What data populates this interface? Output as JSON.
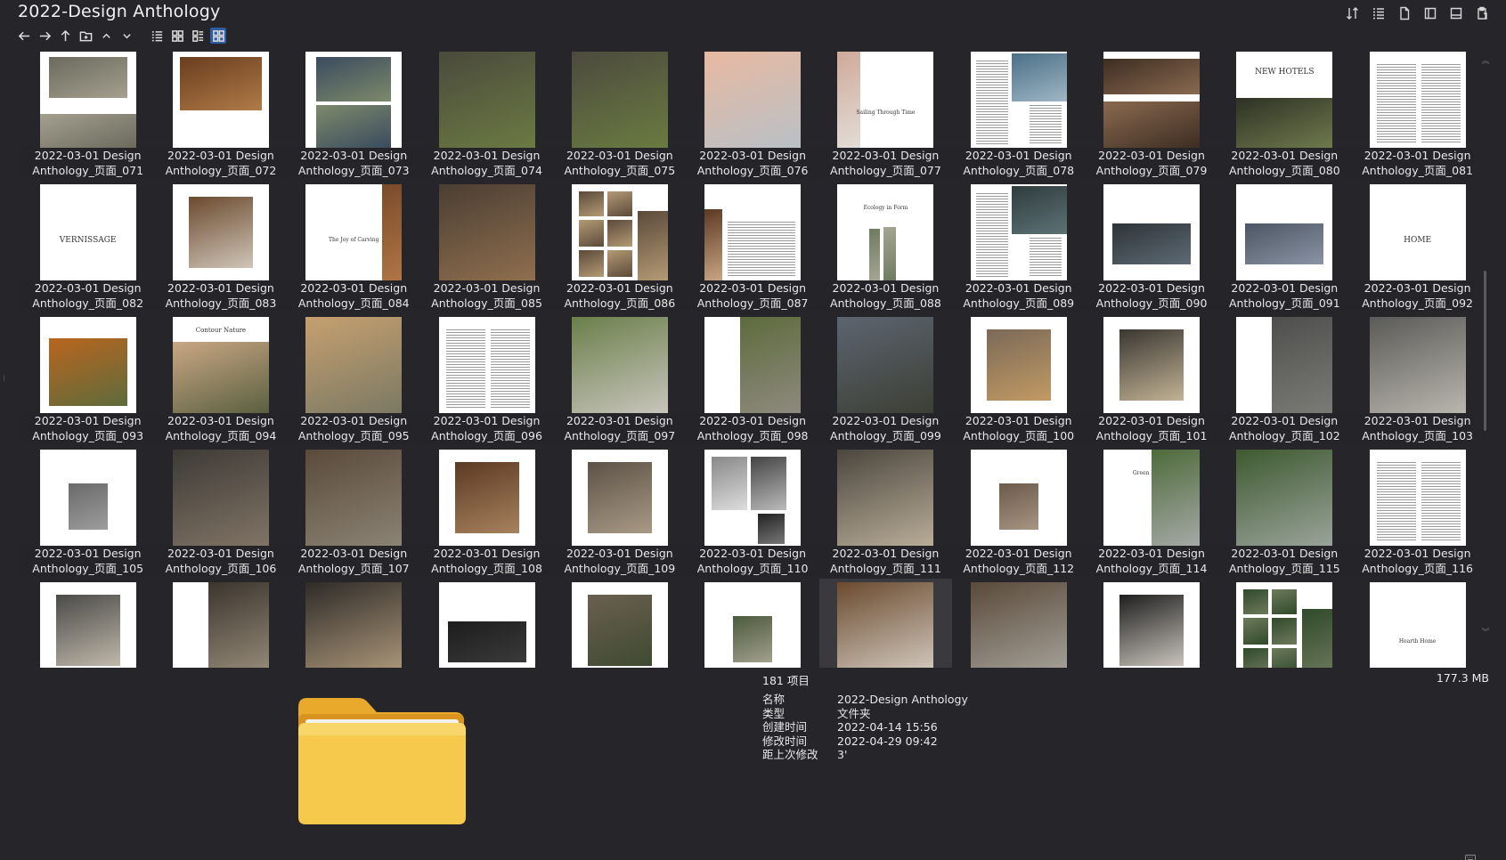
{
  "window": {
    "title": "2022-Design Anthology"
  },
  "top_tools": [
    {
      "name": "sort-icon"
    },
    {
      "name": "list-view-icon"
    },
    {
      "name": "document-icon"
    },
    {
      "name": "preview-pane-icon"
    },
    {
      "name": "details-pane-icon"
    },
    {
      "name": "clipboard-icon"
    }
  ],
  "nav": {
    "back": "back-arrow-icon",
    "forward": "forward-arrow-icon",
    "up": "up-arrow-icon",
    "new_folder": "new-folder-icon"
  },
  "tiles": [
    {
      "label1": "2022-03-01 Design",
      "label2": "Anthology_页面_071",
      "img": "room",
      "c1": "#6b6a5c",
      "c2": "#a4a090"
    },
    {
      "label1": "2022-03-01 Design",
      "label2": "Anthology_页面_072",
      "img": "wood",
      "c1": "#6a3d1f",
      "c2": "#b07b47"
    },
    {
      "label1": "2022-03-01 Design",
      "label2": "Anthology_页面_073",
      "img": "group",
      "c1": "#3a4b5e",
      "c2": "#7d8a6b"
    },
    {
      "label1": "2022-03-01 Design",
      "label2": "Anthology_页面_074",
      "img": "full",
      "c1": "#4a4a3c",
      "c2": "#6b7a42"
    },
    {
      "label1": "2022-03-01 Design",
      "label2": "Anthology_页面_075",
      "img": "full",
      "c1": "#4c4a3e",
      "c2": "#6a7b40"
    },
    {
      "label1": "2022-03-01 Design",
      "label2": "Anthology_页面_076",
      "img": "sea",
      "c1": "#e8b9a0",
      "c2": "#b9c0c6"
    },
    {
      "label1": "2022-03-01 Design",
      "label2": "Anthology_页面_077",
      "img": "splitTitle",
      "text": "Sailing Through Time",
      "c1": "#cfa99a",
      "c2": "#e2ddd6"
    },
    {
      "label1": "2022-03-01 Design",
      "label2": "Anthology_页面_078",
      "img": "textPhoto",
      "c1": "#4b6f86",
      "c2": "#9fb7c5"
    },
    {
      "label1": "2022-03-01 Design",
      "label2": "Anthology_页面_079",
      "img": "hotel",
      "c1": "#8a6a50",
      "c2": "#3d2d22"
    },
    {
      "label1": "2022-03-01 Design",
      "label2": "Anthology_页面_080",
      "img": "titleTop",
      "text": "NEW HOTELS",
      "c1": "#2d3124",
      "c2": "#6f7a4d"
    },
    {
      "label1": "2022-03-01 Design",
      "label2": "Anthology_页面_081",
      "img": "text",
      "c1": "#999",
      "c2": "#bbb"
    },
    {
      "label1": "2022-03-01 Design",
      "label2": "Anthology_页面_082",
      "img": "title",
      "text": "VERNISSAGE",
      "c1": "#fff",
      "c2": "#fff"
    },
    {
      "label1": "2022-03-01 Design",
      "label2": "Anthology_页面_083",
      "img": "center",
      "c1": "#6b4a2e",
      "c2": "#cfc5b8"
    },
    {
      "label1": "2022-03-01 Design",
      "label2": "Anthology_页面_084",
      "img": "smallTitleEdge",
      "text": "The Joy of Carving",
      "c1": "#7a4b2a",
      "c2": "#b07545"
    },
    {
      "label1": "2022-03-01 Design",
      "label2": "Anthology_页面_085",
      "img": "full",
      "c1": "#4b3e33",
      "c2": "#8f6f4e"
    },
    {
      "label1": "2022-03-01 Design",
      "label2": "Anthology_页面_086",
      "img": "collage",
      "c1": "#5b4a3a",
      "c2": "#b49a75"
    },
    {
      "label1": "2022-03-01 Design",
      "label2": "Anthology_页面_087",
      "img": "textLeftPhoto",
      "c1": "#5a3a23",
      "c2": "#c7a583"
    },
    {
      "label1": "2022-03-01 Design",
      "label2": "Anthology_页面_088",
      "img": "titleObj",
      "text": "Ecology in Form",
      "c1": "#6d7b5e",
      "c2": "#a6a693"
    },
    {
      "label1": "2022-03-01 Design",
      "label2": "Anthology_页面_089",
      "img": "textPhoto",
      "c1": "#2f3c3e",
      "c2": "#5d7275"
    },
    {
      "label1": "2022-03-01 Design",
      "label2": "Anthology_页面_090",
      "img": "centerDark",
      "c1": "#2e3438",
      "c2": "#5d6a74"
    },
    {
      "label1": "2022-03-01 Design",
      "label2": "Anthology_页面_091",
      "img": "centerDark",
      "c1": "#4b5563",
      "c2": "#8a94a4"
    },
    {
      "label1": "2022-03-01 Design",
      "label2": "Anthology_页面_092",
      "img": "title",
      "text": "HOME",
      "c1": "#fff",
      "c2": "#fff"
    },
    {
      "label1": "2022-03-01 Design",
      "label2": "Anthology_页面_093",
      "img": "autumn",
      "c1": "#b9651e",
      "c2": "#5e6b3c"
    },
    {
      "label1": "2022-03-01 Design",
      "label2": "Anthology_页面_094",
      "img": "titleScene",
      "text": "Contour Nature",
      "c1": "#c9a784",
      "c2": "#5a6040"
    },
    {
      "label1": "2022-03-01 Design",
      "label2": "Anthology_页面_095",
      "img": "full",
      "c1": "#c6a06f",
      "c2": "#7b7964"
    },
    {
      "label1": "2022-03-01 Design",
      "label2": "Anthology_页面_096",
      "img": "text",
      "c1": "#999",
      "c2": "#bbb"
    },
    {
      "label1": "2022-03-01 Design",
      "label2": "Anthology_页面_097",
      "img": "full",
      "c1": "#6a7f4a",
      "c2": "#c8c5bb"
    },
    {
      "label1": "2022-03-01 Design",
      "label2": "Anthology_页面_098",
      "img": "rightPhoto",
      "c1": "#5d6b3c",
      "c2": "#8e8a7e"
    },
    {
      "label1": "2022-03-01 Design",
      "label2": "Anthology_页面_099",
      "img": "full",
      "c1": "#5c6470",
      "c2": "#3c3f34"
    },
    {
      "label1": "2022-03-01 Design",
      "label2": "Anthology_页面_100",
      "img": "center",
      "c1": "#7a6a58",
      "c2": "#c29a63"
    },
    {
      "label1": "2022-03-01 Design",
      "label2": "Anthology_页面_101",
      "img": "center",
      "c1": "#3a3632",
      "c2": "#c2b394"
    },
    {
      "label1": "2022-03-01 Design",
      "label2": "Anthology_页面_102",
      "img": "rightPhoto",
      "c1": "#4e4e4c",
      "c2": "#7b7b76"
    },
    {
      "label1": "2022-03-01 Design",
      "label2": "Anthology_页面_103",
      "img": "full",
      "c1": "#5a5a58",
      "c2": "#b9b6ad"
    },
    {
      "label1": "2022-03-01 Design",
      "label2": "Anthology_页面_105",
      "img": "smallCenter",
      "c1": "#6a6a6a",
      "c2": "#9d9d9d"
    },
    {
      "label1": "2022-03-01 Design",
      "label2": "Anthology_页面_106",
      "img": "full",
      "c1": "#3d3a36",
      "c2": "#817465"
    },
    {
      "label1": "2022-03-01 Design",
      "label2": "Anthology_页面_107",
      "img": "full",
      "c1": "#5a4a3a",
      "c2": "#8b8374"
    },
    {
      "label1": "2022-03-01 Design",
      "label2": "Anthology_页面_108",
      "img": "center",
      "c1": "#5b3a23",
      "c2": "#a8825e"
    },
    {
      "label1": "2022-03-01 Design",
      "label2": "Anthology_页面_109",
      "img": "center",
      "c1": "#5c5246",
      "c2": "#a99a86"
    },
    {
      "label1": "2022-03-01 Design",
      "label2": "Anthology_页面_110",
      "img": "collage2",
      "c1": "#333",
      "c2": "#aaa"
    },
    {
      "label1": "2022-03-01 Design",
      "label2": "Anthology_页面_111",
      "img": "full",
      "c1": "#4b463e",
      "c2": "#b9ad98"
    },
    {
      "label1": "2022-03-01 Design",
      "label2": "Anthology_页面_112",
      "img": "smallCenter",
      "c1": "#6a5a4a",
      "c2": "#a89583"
    },
    {
      "label1": "2022-03-01 Design",
      "label2": "Anthology_页面_114",
      "img": "titleRightPhoto",
      "text": "Green Escape",
      "c1": "#4e6b3a",
      "c2": "#a5a9a6"
    },
    {
      "label1": "2022-03-01 Design",
      "label2": "Anthology_页面_115",
      "img": "full",
      "c1": "#3e5a30",
      "c2": "#9aa39a"
    },
    {
      "label1": "2022-03-01 Design",
      "label2": "Anthology_页面_116",
      "img": "text",
      "c1": "#999",
      "c2": "#bbb"
    },
    {
      "label1": "",
      "label2": "",
      "img": "center",
      "c1": "#4a4a48",
      "c2": "#c0b8aa"
    },
    {
      "label1": "",
      "label2": "",
      "img": "rightPhoto",
      "c1": "#3b352e",
      "c2": "#9b8f7c"
    },
    {
      "label1": "",
      "label2": "",
      "img": "full",
      "c1": "#2e2b28",
      "c2": "#b29c7d"
    },
    {
      "label1": "",
      "label2": "",
      "img": "centerDark",
      "c1": "#1d1d1d",
      "c2": "#3a3a3a"
    },
    {
      "label1": "",
      "label2": "",
      "img": "center",
      "c1": "#6a5f50",
      "c2": "#3f4a32"
    },
    {
      "label1": "",
      "label2": "",
      "img": "smallCenter",
      "c1": "#4c5a3b",
      "c2": "#a2a08f"
    },
    {
      "label1": "",
      "label2": "",
      "img": "full",
      "c1": "#6a4a2e",
      "c2": "#d8d0c6",
      "selected": true
    },
    {
      "label1": "",
      "label2": "",
      "img": "full",
      "c1": "#5a4a3a",
      "c2": "#a8a59d"
    },
    {
      "label1": "",
      "label2": "",
      "img": "center",
      "c1": "#1e1e1e",
      "c2": "#c9c4bc"
    },
    {
      "label1": "",
      "label2": "",
      "img": "collage",
      "c1": "#2f4a2a",
      "c2": "#6e7a5c"
    },
    {
      "label1": "",
      "label2": "",
      "img": "titleSmall",
      "text": "Hearth Home",
      "c1": "#fff",
      "c2": "#fff"
    }
  ],
  "details": {
    "count": "181 项目",
    "size": "177.3 MB",
    "props": [
      {
        "key": "名称",
        "value": "2022-Design Anthology"
      },
      {
        "key": "类型",
        "value": "文件夹"
      },
      {
        "key": "创建时间",
        "value": "2022-04-14  15:56"
      },
      {
        "key": "修改时间",
        "value": "2022-04-29  09:42"
      },
      {
        "key": "距上次修改",
        "value": "3'"
      }
    ],
    "folder_icon": "folder-icon",
    "folder_color": "#f4c542"
  }
}
